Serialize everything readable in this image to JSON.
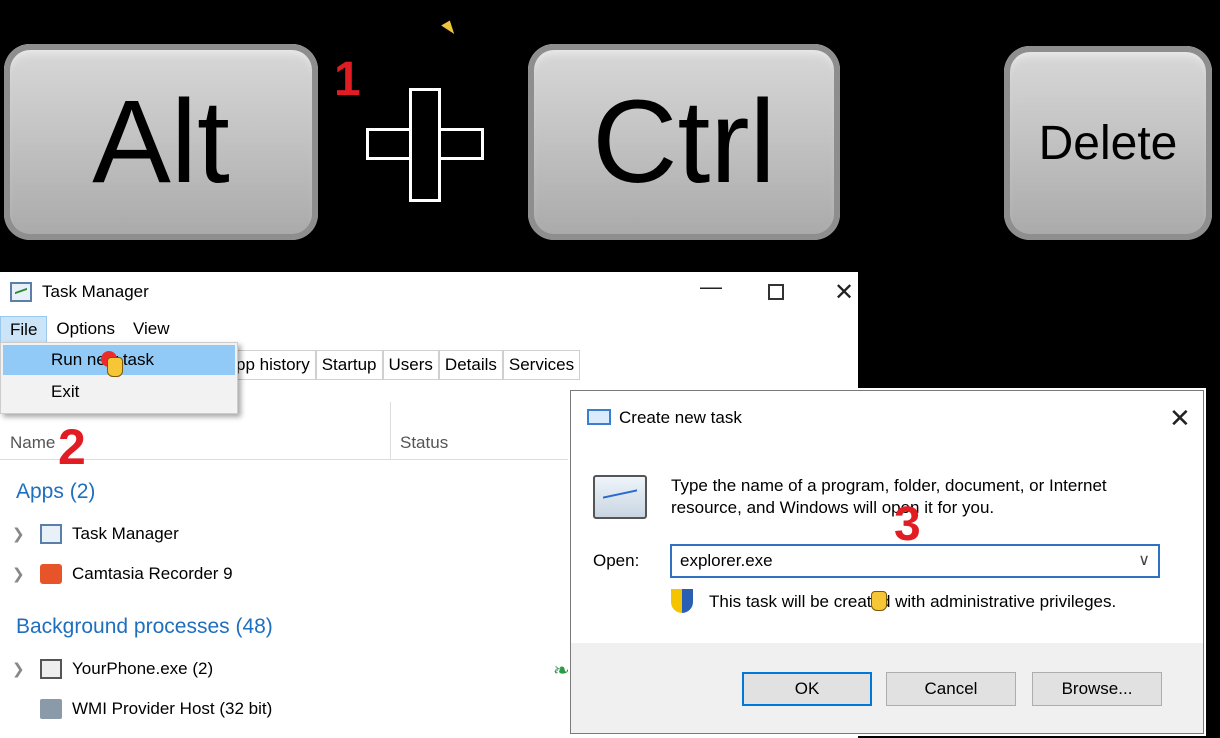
{
  "keys": {
    "alt": "Alt",
    "ctrl": "Ctrl",
    "delete": "Delete",
    "plus_icon": "plus-icon"
  },
  "steps": [
    "1",
    "2",
    "3"
  ],
  "task_manager": {
    "title": "Task Manager",
    "menu": [
      "File",
      "Options",
      "View"
    ],
    "file_menu": {
      "run_new_task": "Run new task",
      "exit": "Exit"
    },
    "tabs": [
      "pp history",
      "Startup",
      "Users",
      "Details",
      "Services"
    ],
    "columns": {
      "name": "Name",
      "status": "Status"
    },
    "apps_group": "Apps (2)",
    "apps": [
      {
        "name": "Task Manager",
        "icon": "task-manager-icon"
      },
      {
        "name": "Camtasia Recorder 9",
        "icon": "camtasia-icon"
      }
    ],
    "background_group": "Background processes (48)",
    "background": [
      {
        "name": "YourPhone.exe (2)",
        "icon": "app-window-icon"
      },
      {
        "name": "WMI Provider Host (32 bit)",
        "icon": "wmi-icon"
      }
    ]
  },
  "create_task": {
    "title": "Create new task",
    "description": "Type the name of a program, folder, document, or Internet resource, and Windows will open it for you.",
    "open_label": "Open:",
    "open_value": "explorer.exe",
    "admin_note": "This task will be created with administrative privileges.",
    "ok": "OK",
    "cancel": "Cancel",
    "browse": "Browse..."
  },
  "colors": {
    "step_red": "#e21c23",
    "group_blue": "#1f6fbf",
    "menu_highlight": "#91c9f7",
    "input_border": "#2f72c4"
  }
}
